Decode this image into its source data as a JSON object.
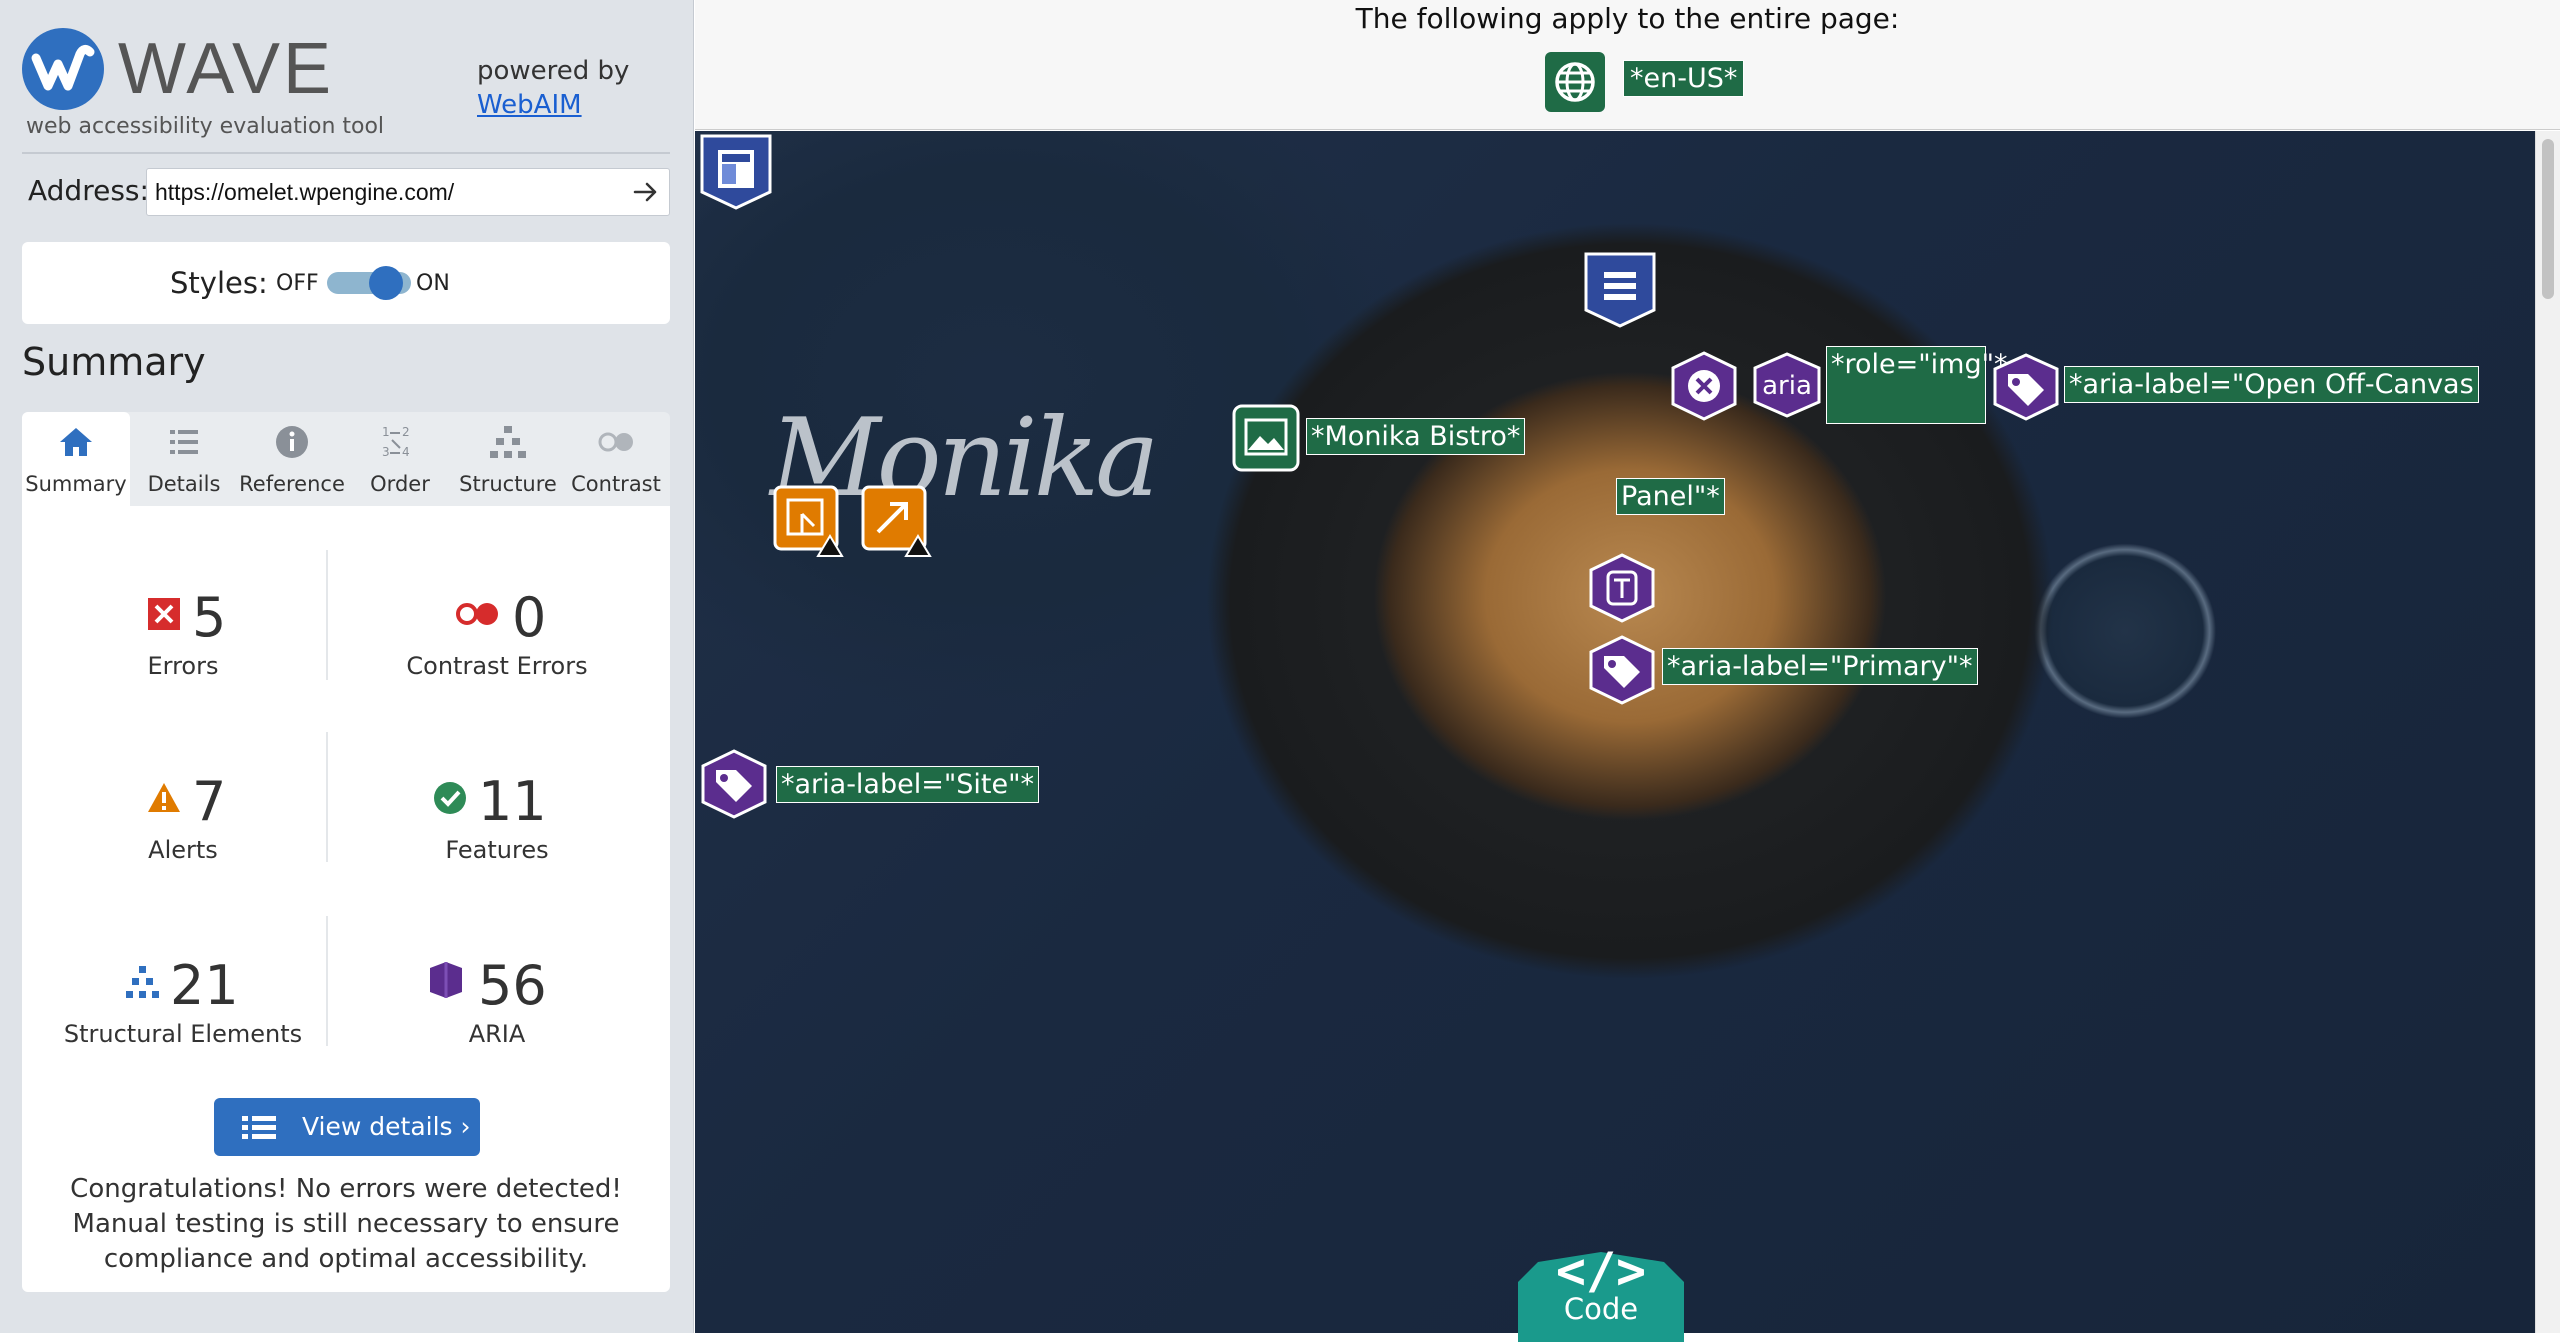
{
  "sidebar": {
    "logo_text": "WAVE",
    "logo_subtitle": "web accessibility evaluation tool",
    "powered_by": "powered by",
    "powered_link": "WebAIM",
    "address_label": "Address:",
    "address_value": "https://omelet.wpengine.com/",
    "styles_label": "Styles:",
    "styles_off": "OFF",
    "styles_on": "ON",
    "summary_heading": "Summary",
    "tabs": [
      {
        "label": "Summary",
        "icon": "home-icon",
        "active": true
      },
      {
        "label": "Details",
        "icon": "list-icon"
      },
      {
        "label": "Reference",
        "icon": "info-icon"
      },
      {
        "label": "Order",
        "icon": "order-icon"
      },
      {
        "label": "Structure",
        "icon": "structure-icon"
      },
      {
        "label": "Contrast",
        "icon": "contrast-icon"
      }
    ],
    "stats": {
      "errors": {
        "value": "5",
        "label": "Errors"
      },
      "contrast_errors": {
        "value": "0",
        "label": "Contrast Errors"
      },
      "alerts": {
        "value": "7",
        "label": "Alerts"
      },
      "features": {
        "value": "11",
        "label": "Features"
      },
      "structural": {
        "value": "21",
        "label": "Structural Elements"
      },
      "aria": {
        "value": "56",
        "label": "ARIA"
      }
    },
    "view_details": "View details ›",
    "congrats": "Congratulations! No errors were detected! Manual testing is still necessary to ensure compliance and optimal accessibility."
  },
  "topbar": {
    "text": "The following apply to the entire page:",
    "lang_label": "*en-US*"
  },
  "preview": {
    "signature": "Monika",
    "labels": {
      "monika_bistro": "*Monika Bistro*",
      "role_img": "*role=\"img\"*",
      "open_offcanvas": "*aria-label=\"Open Off-Canvas",
      "panel": "Panel\"*",
      "primary": "*aria-label=\"Primary\"*",
      "site": "*aria-label=\"Site\"*"
    },
    "aria_badge": "aria",
    "code_glyph": "</>",
    "code_label": "Code"
  },
  "colors": {
    "brand_blue": "#2f6fbf",
    "feature_green": "#1f6b46",
    "aria_purple": "#5b2d8e",
    "alert_orange": "#e07b00",
    "error_red": "#d62c2c",
    "code_teal": "#1a9a8c"
  }
}
